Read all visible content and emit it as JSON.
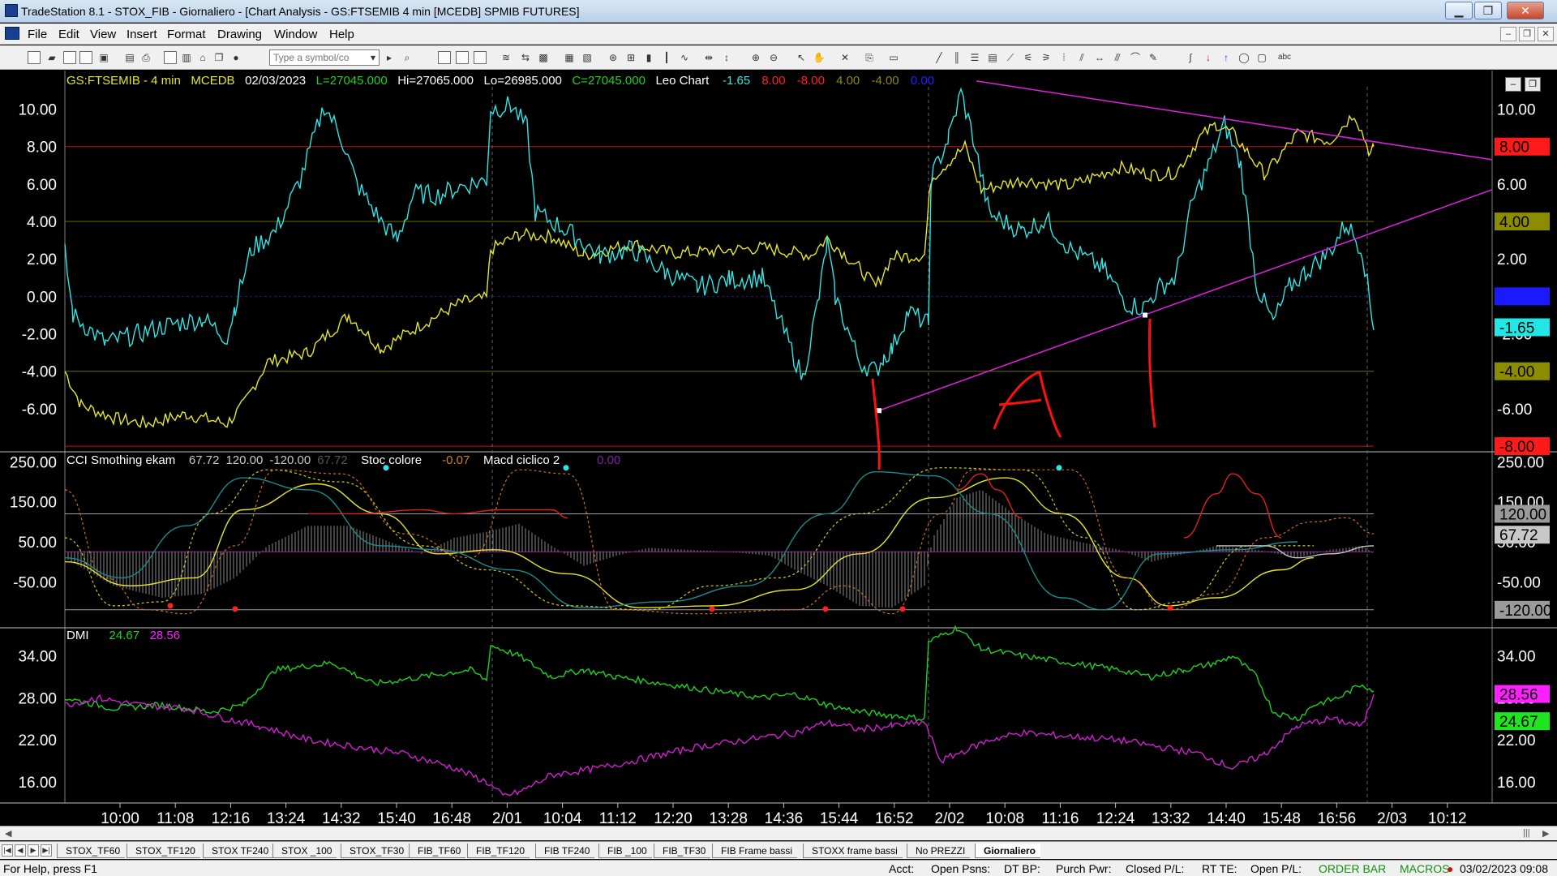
{
  "window": {
    "title": "TradeStation 8.1 - STOX_FIB - Giornaliero - [Chart Analysis - GS:FTSEMIB  4 min  [MCEDB] SPMIB FUTURES]",
    "minimize": "▁",
    "maximize": "❐",
    "close": "✕"
  },
  "menu": {
    "items": [
      "File",
      "Edit",
      "View",
      "Insert",
      "Format",
      "Drawing",
      "Window",
      "Help"
    ],
    "mdi": [
      "–",
      "❐",
      "✕"
    ]
  },
  "toolbar": {
    "symbol_placeholder": "Type a symbol/co",
    "abc": "abc"
  },
  "chart": {
    "price_header": {
      "symbol": "GS:FTSEMIB - 4 min",
      "exchange": "MCEDB",
      "date": "02/03/2023",
      "last": "L=27045.000",
      "hi": "Hi=27065.000",
      "lo": "Lo=26985.000",
      "close": "C=27045.000",
      "study": "Leo Chart",
      "values": [
        {
          "text": "-1.65",
          "color": "#2ee6e6"
        },
        {
          "text": "8.00",
          "color": "#ff2020"
        },
        {
          "text": "-8.00",
          "color": "#ff2020"
        },
        {
          "text": "4.00",
          "color": "#8a8a00"
        },
        {
          "text": "-4.00",
          "color": "#8a8a00"
        },
        {
          "text": "0.00",
          "color": "#2020ff"
        }
      ]
    },
    "osc_header": {
      "name": "CCI Smothing ekam",
      "vals": [
        {
          "text": "67.72",
          "color": "#c8c8c8"
        },
        {
          "text": "120.00",
          "color": "#c8c8c8"
        },
        {
          "text": "-120.00",
          "color": "#c8c8c8"
        },
        {
          "text": "67.72",
          "color": "#555555"
        }
      ],
      "stoc": "Stoc colore",
      "stoc_val": "-0.07",
      "macd": "Macd ciclico 2",
      "macd_val": "0.00"
    },
    "dmi_header": {
      "name": "DMI",
      "plus": "24.67",
      "minus": "28.56"
    },
    "price_axis": [
      "10.00",
      "8.00",
      "6.00",
      "4.00",
      "2.00",
      "0.00",
      "-2.00",
      "-4.00",
      "-6.00"
    ],
    "price_axis_values": [
      10,
      8,
      6,
      4,
      2,
      0,
      -2,
      -4,
      -6
    ],
    "price_range": [
      -8.3,
      11.8
    ],
    "osc_axis": [
      "250.00",
      "150.00",
      "50.00",
      "-50.00"
    ],
    "osc_axis_values": [
      250,
      150,
      50,
      -50
    ],
    "osc_range": [
      -165,
      275
    ],
    "dmi_axis": [
      "34.00",
      "28.00",
      "22.00",
      "16.00"
    ],
    "dmi_axis_values": [
      34,
      28,
      22,
      16
    ],
    "dmi_range": [
      13,
      38
    ],
    "price_tags": [
      {
        "text": "8.00",
        "value": 8,
        "bg": "#ff1a1a",
        "fg": "#000000"
      },
      {
        "text": "4.00",
        "value": 4,
        "bg": "#8c8c00",
        "fg": "#000000"
      },
      {
        "text": "0.00",
        "value": 0,
        "bg": "#1a1aff",
        "fg": "#1a1aff"
      },
      {
        "text": "-1.65",
        "value": -1.65,
        "bg": "#22e6e6",
        "fg": "#000000"
      },
      {
        "text": "-4.00",
        "value": -4,
        "bg": "#8c8c00",
        "fg": "#000000"
      },
      {
        "text": "-8.00",
        "value": -8,
        "bg": "#ff1a1a",
        "fg": "#000000"
      }
    ],
    "osc_tags": [
      {
        "text": "120.00",
        "value": 120,
        "bg": "#9a9a9a",
        "fg": "#000000"
      },
      {
        "text": "67.72",
        "value": 67.72,
        "bg": "#c8c8c8",
        "fg": "#000000"
      },
      {
        "text": "-120.00",
        "value": -120,
        "bg": "#9a9a9a",
        "fg": "#000000"
      }
    ],
    "dmi_tags": [
      {
        "text": "28.56",
        "value": 28.56,
        "bg": "#ff20ff",
        "fg": "#000000"
      },
      {
        "text": "24.67",
        "value": 24.67,
        "bg": "#20e620",
        "fg": "#000000"
      }
    ],
    "time_labels": [
      "10:00",
      "11:08",
      "12:16",
      "13:24",
      "14:32",
      "15:40",
      "16:48",
      "2/01",
      "10:04",
      "11:12",
      "12:20",
      "13:28",
      "14:36",
      "15:44",
      "16:52",
      "2/02",
      "10:08",
      "11:16",
      "12:24",
      "13:32",
      "14:40",
      "15:48",
      "16:56",
      "2/03",
      "10:12"
    ],
    "annotation": "A",
    "colors": {
      "cyan": "#2ee6e6",
      "yellow": "#e6e62e",
      "magenta": "#e020e0",
      "green": "#20d020",
      "red": "#ff1a1a",
      "olive": "#8c8c00"
    }
  },
  "tabs": {
    "items": [
      "STOX_TF60",
      "STOX_TF120",
      "STOX TF240",
      "STOX _100",
      "STOX_TF30",
      "FIB_TF60",
      "FIB_TF120",
      "FIB TF240",
      "FIB _100",
      "FIB_TF30",
      "FIB Frame bassi",
      "STOXX frame bassi",
      "No PREZZI",
      "Giornaliero"
    ],
    "active": "Giornaliero"
  },
  "status": {
    "help": "For Help, press F1",
    "acct": "Acct:",
    "open_psns": "Open Psns:",
    "dt_bp": "DT BP:",
    "purch_pwr": "Purch Pwr:",
    "closed_pl": "Closed P/L:",
    "rt_te": "RT TE:",
    "open_pl": "Open P/L:",
    "order_bar": "ORDER BAR",
    "macros": "MACROS",
    "datetime": "03/02/2023 09:08"
  }
}
